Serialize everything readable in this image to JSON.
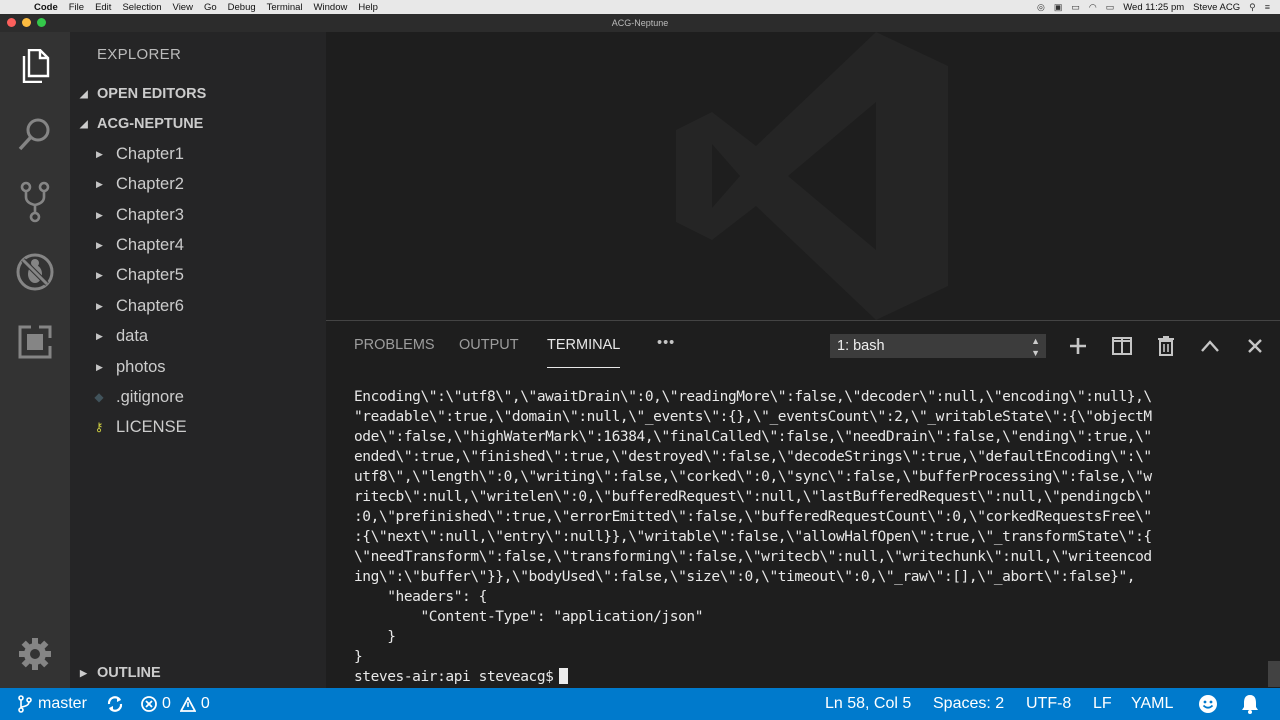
{
  "menubar": {
    "app": "Code",
    "items": [
      "File",
      "Edit",
      "Selection",
      "View",
      "Go",
      "Debug",
      "Terminal",
      "Window",
      "Help"
    ],
    "clock": "Wed 11:25 pm",
    "user": "Steve ACG"
  },
  "window": {
    "title": "ACG-Neptune"
  },
  "sidebar": {
    "title": "EXPLORER",
    "open_editors": "OPEN EDITORS",
    "project": "ACG-NEPTUNE",
    "items": [
      {
        "label": "Chapter1",
        "type": "folder"
      },
      {
        "label": "Chapter2",
        "type": "folder"
      },
      {
        "label": "Chapter3",
        "type": "folder"
      },
      {
        "label": "Chapter4",
        "type": "folder"
      },
      {
        "label": "Chapter5",
        "type": "folder"
      },
      {
        "label": "Chapter6",
        "type": "folder"
      },
      {
        "label": "data",
        "type": "folder"
      },
      {
        "label": "photos",
        "type": "folder"
      },
      {
        "label": ".gitignore",
        "type": "file"
      },
      {
        "label": "LICENSE",
        "type": "file"
      }
    ],
    "outline": "OUTLINE"
  },
  "panel": {
    "tabs": [
      "PROBLEMS",
      "OUTPUT",
      "TERMINAL"
    ],
    "active_tab": "TERMINAL",
    "more": "•••",
    "terminal_select": "1: bash"
  },
  "terminal": {
    "lines": [
      "Encoding\\\":\\\"utf8\\\",\\\"awaitDrain\\\":0,\\\"readingMore\\\":false,\\\"decoder\\\":null,\\\"encoding\\\":null},\\",
      "\"readable\\\":true,\\\"domain\\\":null,\\\"_events\\\":{},\\\"_eventsCount\\\":2,\\\"_writableState\\\":{\\\"objectM",
      "ode\\\":false,\\\"highWaterMark\\\":16384,\\\"finalCalled\\\":false,\\\"needDrain\\\":false,\\\"ending\\\":true,\\\"",
      "ended\\\":true,\\\"finished\\\":true,\\\"destroyed\\\":false,\\\"decodeStrings\\\":true,\\\"defaultEncoding\\\":\\\"",
      "utf8\\\",\\\"length\\\":0,\\\"writing\\\":false,\\\"corked\\\":0,\\\"sync\\\":false,\\\"bufferProcessing\\\":false,\\\"w",
      "ritecb\\\":null,\\\"writelen\\\":0,\\\"bufferedRequest\\\":null,\\\"lastBufferedRequest\\\":null,\\\"pendingcb\\\"",
      ":0,\\\"prefinished\\\":true,\\\"errorEmitted\\\":false,\\\"bufferedRequestCount\\\":0,\\\"corkedRequestsFree\\\"",
      ":{\\\"next\\\":null,\\\"entry\\\":null}},\\\"writable\\\":false,\\\"allowHalfOpen\\\":true,\\\"_transformState\\\":{",
      "\\\"needTransform\\\":false,\\\"transforming\\\":false,\\\"writecb\\\":null,\\\"writechunk\\\":null,\\\"writeencod",
      "ing\\\":\\\"buffer\\\"}},\\\"bodyUsed\\\":false,\\\"size\\\":0,\\\"timeout\\\":0,\\\"_raw\\\":[],\\\"_abort\\\":false}\",",
      "    \"headers\": {",
      "        \"Content-Type\": \"application/json\"",
      "    }",
      "}"
    ],
    "prompt": "steves-air:api steveacg$"
  },
  "statusbar": {
    "branch": "master",
    "errors": "0",
    "warnings": "0",
    "position": "Ln 58, Col 5",
    "spaces": "Spaces: 2",
    "encoding": "UTF-8",
    "eol": "LF",
    "language": "YAML"
  },
  "colors": {
    "statusbar": "#007acc",
    "activitybar": "#333333",
    "sidebar": "#252526",
    "editor": "#1e1e1e"
  }
}
